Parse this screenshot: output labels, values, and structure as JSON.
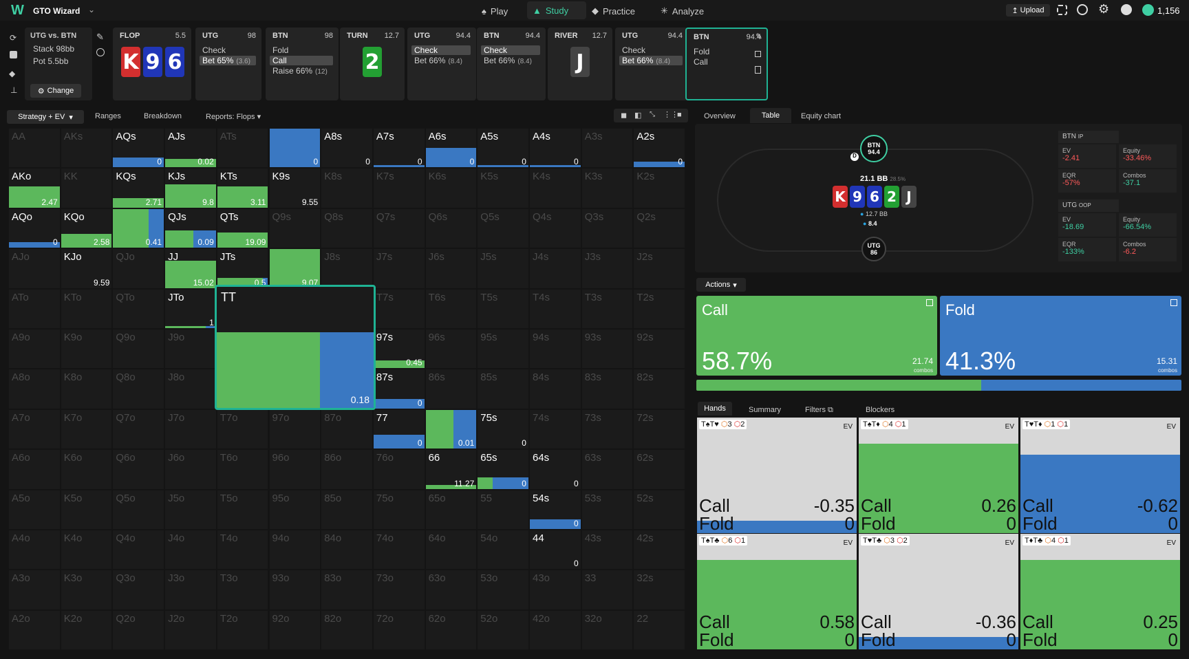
{
  "app": {
    "title": "GTO Wizard"
  },
  "nav": [
    {
      "label": "Play"
    },
    {
      "label": "Study"
    },
    {
      "label": "Practice"
    },
    {
      "label": "Analyze"
    }
  ],
  "topright": {
    "upload": "Upload",
    "balance": "1,156"
  },
  "spot": {
    "title": "UTG vs. BTN",
    "stack": "Stack 98bb",
    "pot": "Pot 5.5bb",
    "change": "Change"
  },
  "history": [
    {
      "street": "FLOP",
      "pot": "5.5",
      "cards": [
        "K",
        "9",
        "6"
      ]
    },
    {
      "street": "UTG",
      "pot": "98",
      "acts": [
        {
          "t": "Check",
          "s": ""
        },
        {
          "t": "Bet 65%",
          "s": "(3.6)"
        }
      ]
    },
    {
      "street": "BTN",
      "pot": "98",
      "acts": [
        {
          "t": "Fold",
          "s": ""
        },
        {
          "t": "Call",
          "s": ""
        },
        {
          "t": "Raise 66%",
          "s": "(12)"
        }
      ]
    },
    {
      "street": "TURN",
      "pot": "12.7",
      "cards": [
        "2"
      ]
    },
    {
      "street": "UTG",
      "pot": "94.4",
      "acts": [
        {
          "t": "Check",
          "s": ""
        },
        {
          "t": "Bet 66%",
          "s": "(8.4)"
        }
      ]
    },
    {
      "street": "BTN",
      "pot": "94.4",
      "acts": [
        {
          "t": "Check",
          "s": ""
        },
        {
          "t": "Bet 66%",
          "s": "(8.4)"
        }
      ]
    },
    {
      "street": "RIVER",
      "pot": "12.7",
      "cards": [
        "J"
      ]
    },
    {
      "street": "UTG",
      "pot": "94.4",
      "acts": [
        {
          "t": "Check",
          "s": ""
        },
        {
          "t": "Bet 66%",
          "s": "(8.4)"
        }
      ]
    },
    {
      "street": "BTN",
      "pot": "94.4",
      "acts": [
        {
          "t": "Fold",
          "s": ""
        },
        {
          "t": "Call",
          "s": ""
        }
      ]
    }
  ],
  "toolbar": {
    "strategy": "Strategy + EV",
    "ranges": "Ranges",
    "breakdown": "Breakdown",
    "reports": "Reports: Flops"
  },
  "righttabs": {
    "overview": "Overview",
    "table": "Table",
    "equity": "Equity chart"
  },
  "table": {
    "btn": "BTN",
    "btn_stack": "94.4",
    "pot": "21.1 BB",
    "pot_pct": "28.5%",
    "utg": "UTG",
    "utg_stack": "86",
    "bet1": "12.7 BB",
    "bet2": "8.4",
    "board": [
      "K",
      "9",
      "6",
      "2",
      "J"
    ]
  },
  "stats": {
    "btn": {
      "label": "BTN",
      "pos": "IP",
      "ev_l": "EV",
      "ev": "-2.41",
      "eq_l": "Equity",
      "eq": "-33.46%",
      "eqr_l": "EQR",
      "eqr": "-57%",
      "co_l": "Combos",
      "co": "-37.1"
    },
    "utg": {
      "label": "UTG",
      "pos": "OOP",
      "ev_l": "EV",
      "ev": "-18.69",
      "eq_l": "Equity",
      "eq": "-66.54%",
      "eqr_l": "EQR",
      "eqr": "-133%",
      "co_l": "Combos",
      "co": "-6.2"
    }
  },
  "actions": {
    "label": "Actions",
    "call": "Call",
    "call_pct": "58.7%",
    "call_combos": "21.74",
    "fold": "Fold",
    "fold_pct": "41.3%",
    "fold_combos": "15.31",
    "combos_l": "combos"
  },
  "handtabs": {
    "hands": "Hands",
    "summary": "Summary",
    "filters": "Filters",
    "blockers": "Blockers"
  },
  "hands": [
    {
      "combo": "T♠T♥",
      "b1": "3",
      "b2": "2",
      "ev": "EV",
      "call": "-0.35",
      "fold": "0",
      "callpct": 0
    },
    {
      "combo": "T♠T♦",
      "b1": "4",
      "b2": "1",
      "ev": "EV",
      "call": "0.26",
      "fold": "0",
      "callpct": 1
    },
    {
      "combo": "T♥T♦",
      "b1": "1",
      "b2": "1",
      "ev": "EV",
      "call": "-0.62",
      "fold": "0",
      "callpct": 0
    },
    {
      "combo": "T♠T♣",
      "b1": "6",
      "b2": "1",
      "ev": "EV",
      "call": "0.58",
      "fold": "0",
      "callpct": 1
    },
    {
      "combo": "T♥T♣",
      "b1": "3",
      "b2": "2",
      "ev": "EV",
      "call": "-0.36",
      "fold": "0",
      "callpct": 0
    },
    {
      "combo": "T♦T♣",
      "b1": "4",
      "b2": "1",
      "ev": "EV",
      "call": "0.25",
      "fold": "0",
      "callpct": 1
    }
  ],
  "grid": [
    [
      "AA",
      "AKs",
      "AQs",
      "AJs",
      "ATs",
      "A9s",
      "A8s",
      "A7s",
      "A6s",
      "A5s",
      "A4s",
      "A3s",
      "A2s"
    ],
    [
      "AKo",
      "KK",
      "KQs",
      "KJs",
      "KTs",
      "K9s",
      "K8s",
      "K7s",
      "K6s",
      "K5s",
      "K4s",
      "K3s",
      "K2s"
    ],
    [
      "AQo",
      "KQo",
      "QQ",
      "QJs",
      "QTs",
      "Q9s",
      "Q8s",
      "Q7s",
      "Q6s",
      "Q5s",
      "Q4s",
      "Q3s",
      "Q2s"
    ],
    [
      "AJo",
      "KJo",
      "QJo",
      "JJ",
      "JTs",
      "J9s",
      "J8s",
      "J7s",
      "J6s",
      "J5s",
      "J4s",
      "J3s",
      "J2s"
    ],
    [
      "ATo",
      "KTo",
      "QTo",
      "JTo",
      "TT",
      "T9s",
      "T8s",
      "T7s",
      "T6s",
      "T5s",
      "T4s",
      "T3s",
      "T2s"
    ],
    [
      "A9o",
      "K9o",
      "Q9o",
      "J9o",
      "T9o",
      "99",
      "98s",
      "97s",
      "96s",
      "95s",
      "94s",
      "93s",
      "92s"
    ],
    [
      "A8o",
      "K8o",
      "Q8o",
      "J8o",
      "T8o",
      "98o",
      "88",
      "87s",
      "86s",
      "85s",
      "84s",
      "83s",
      "82s"
    ],
    [
      "A7o",
      "K7o",
      "Q7o",
      "J7o",
      "T7o",
      "97o",
      "87o",
      "77",
      "76s",
      "75s",
      "74s",
      "73s",
      "72s"
    ],
    [
      "A6o",
      "K6o",
      "Q6o",
      "J6o",
      "T6o",
      "96o",
      "86o",
      "76o",
      "66",
      "65s",
      "64s",
      "63s",
      "62s"
    ],
    [
      "A5o",
      "K5o",
      "Q5o",
      "J5o",
      "T5o",
      "95o",
      "85o",
      "75o",
      "65o",
      "55",
      "54s",
      "53s",
      "52s"
    ],
    [
      "A4o",
      "K4o",
      "Q4o",
      "J4o",
      "T4o",
      "94o",
      "84o",
      "74o",
      "64o",
      "54o",
      "44",
      "43s",
      "42s"
    ],
    [
      "A3o",
      "K3o",
      "Q3o",
      "J3o",
      "T3o",
      "93o",
      "83o",
      "73o",
      "63o",
      "53o",
      "43o",
      "33",
      "32s"
    ],
    [
      "A2o",
      "K2o",
      "Q2o",
      "J2o",
      "T2o",
      "92o",
      "82o",
      "72o",
      "62o",
      "52o",
      "42o",
      "32o",
      "22"
    ]
  ],
  "active": {
    "AQs": {
      "ev": "0",
      "g": 0,
      "b": 1,
      "h": 0.25
    },
    "AJs": {
      "ev": "0.02",
      "g": 1,
      "b": 0,
      "h": 0.22
    },
    "A9s": {
      "ev": "0",
      "g": 0,
      "b": 1,
      "h": 1
    },
    "A8s": {
      "ev": "0",
      "g": 0,
      "b": 0,
      "h": 0
    },
    "A7s": {
      "ev": "0",
      "g": 0,
      "b": 1,
      "h": 0.06
    },
    "A6s": {
      "ev": "0",
      "g": 0,
      "b": 1,
      "h": 0.5
    },
    "A5s": {
      "ev": "0",
      "g": 0,
      "b": 1,
      "h": 0.06
    },
    "A4s": {
      "ev": "0",
      "g": 0,
      "b": 1,
      "h": 0.06
    },
    "A2s": {
      "ev": "0",
      "g": 0,
      "b": 1,
      "h": 0.15
    },
    "AKo": {
      "ev": "2.47",
      "g": 1,
      "b": 0,
      "h": 0.55
    },
    "KQs": {
      "ev": "2.71",
      "g": 1,
      "b": 0,
      "h": 0.25
    },
    "KJs": {
      "ev": "9.8",
      "g": 1,
      "b": 0,
      "h": 0.6
    },
    "KTs": {
      "ev": "3.11",
      "g": 1,
      "b": 0,
      "h": 0.55
    },
    "K9s": {
      "ev": "9.55",
      "g": 0,
      "b": 0,
      "h": 0
    },
    "AQo": {
      "ev": "0",
      "g": 0,
      "b": 1,
      "h": 0.15
    },
    "KQo": {
      "ev": "2.58",
      "g": 1,
      "b": 0,
      "h": 0.35
    },
    "QQ": {
      "ev": "0.41",
      "g": 0.7,
      "b": 0.3,
      "h": 1
    },
    "QJs": {
      "ev": "0.09",
      "g": 0.55,
      "b": 0.45,
      "h": 0.45
    },
    "QTs": {
      "ev": "19.09",
      "g": 1,
      "b": 0,
      "h": 0.4
    },
    "KJo": {
      "ev": "9.59",
      "g": 0,
      "b": 0,
      "h": 0
    },
    "JJ": {
      "ev": "15.02",
      "g": 1,
      "b": 0,
      "h": 0.7
    },
    "JTs": {
      "ev": "0.5",
      "g": 0.9,
      "b": 0.1,
      "h": 0.25
    },
    "J9s": {
      "ev": "9.07",
      "g": 1,
      "b": 0,
      "h": 1
    },
    "JTo": {
      "ev": "1",
      "g": 0.8,
      "b": 0.2,
      "h": 0.06
    },
    "97s": {
      "ev": "0.45",
      "g": 1,
      "b": 0,
      "h": 0.2
    },
    "87s": {
      "ev": "0",
      "g": 0,
      "b": 1,
      "h": 0.25
    },
    "77": {
      "ev": "0",
      "g": 0,
      "b": 1,
      "h": 0.35
    },
    "76s": {
      "ev": "0.01",
      "g": 0.55,
      "b": 0.45,
      "h": 1
    },
    "75s": {
      "ev": "0",
      "g": 0,
      "b": 0,
      "h": 0
    },
    "66": {
      "ev": "11.27",
      "g": 1,
      "b": 0,
      "h": 0.1
    },
    "65s": {
      "ev": "0",
      "g": 0.3,
      "b": 0.7,
      "h": 0.3
    },
    "64s": {
      "ev": "0",
      "g": 0,
      "b": 0,
      "h": 0
    },
    "54s": {
      "ev": "0",
      "g": 0,
      "b": 1,
      "h": 0.25
    },
    "44": {
      "ev": "0",
      "g": 0,
      "b": 0,
      "h": 0
    }
  },
  "zoom": {
    "hand": "TT",
    "ev": "0.18"
  }
}
